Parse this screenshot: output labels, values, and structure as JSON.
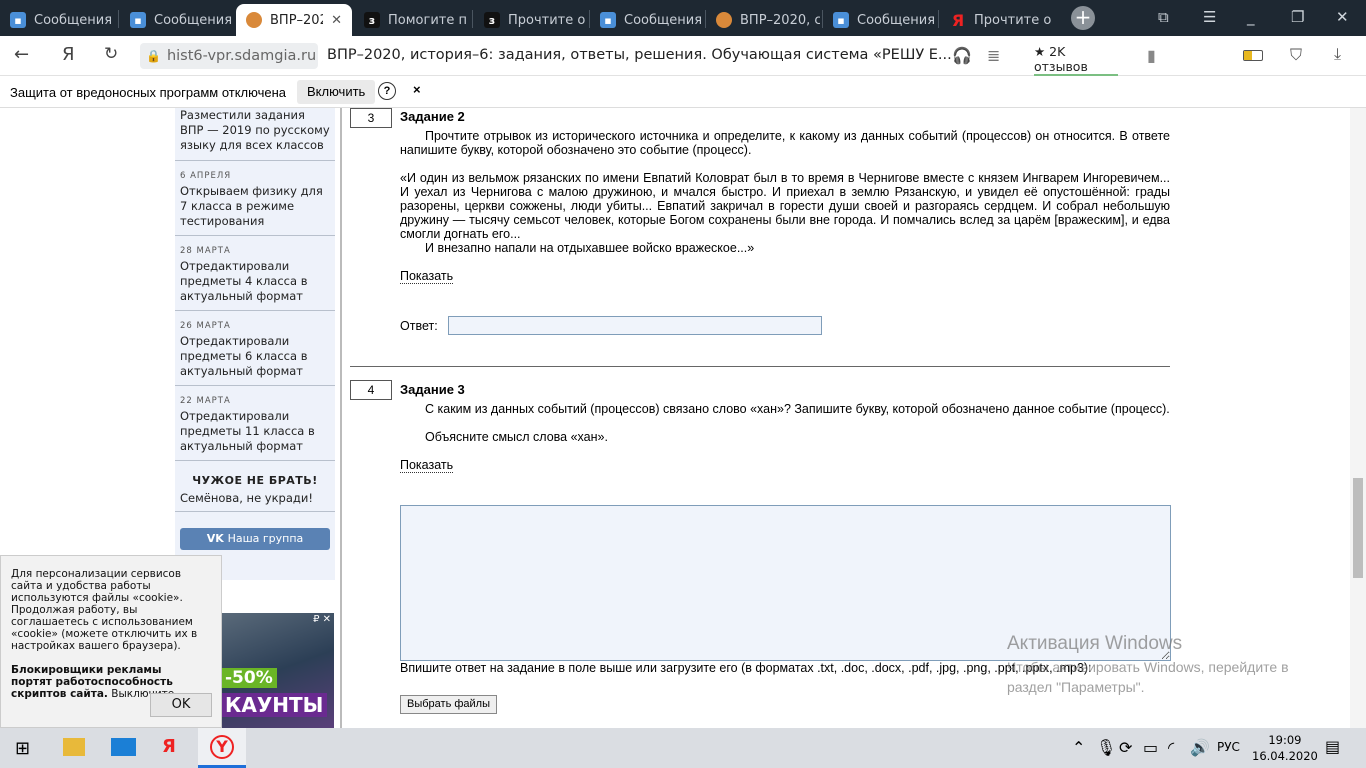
{
  "browser": {
    "tabs": [
      {
        "label": "Сообщения",
        "icon": "messages-icon"
      },
      {
        "label": "Сообщения",
        "icon": "messages-icon"
      },
      {
        "label": "ВПР–2020",
        "icon": "sdamgia-icon",
        "active": true
      },
      {
        "label": "Помогите п",
        "icon": "znanija-icon"
      },
      {
        "label": "Прочтите о",
        "icon": "znanija-icon"
      },
      {
        "label": "Сообщения",
        "icon": "messages-icon"
      },
      {
        "label": "ВПР–2020, с",
        "icon": "sdamgia-icon"
      },
      {
        "label": "Сообщения",
        "icon": "messages-icon"
      },
      {
        "label": "Прочтите о",
        "icon": "yandex-icon"
      }
    ],
    "domain": "hist6-vpr.sdamgia.ru",
    "page_title": "ВПР–2020, история–6: задания, ответы, решения. Обучающая система «РЕШУ Е...",
    "reviews": "★ 2K отзывов",
    "notice": {
      "text": "Защита от вредоносных программ отключена",
      "button": "Включить",
      "help": "?",
      "close": "×"
    }
  },
  "sidebar": {
    "news": [
      {
        "date": "",
        "title": "Разместили задания ВПР — 2019 по русскому языку для всех классов"
      },
      {
        "date": "6 АПРЕЛЯ",
        "title": "Открываем физику для 7 класса в режиме тестирования"
      },
      {
        "date": "28 МАРТА",
        "title": "Отредактировали предметы 4 класса в актуальный формат"
      },
      {
        "date": "26 МАРТА",
        "title": "Отредактировали предметы 6 класса в актуальный формат"
      },
      {
        "date": "22 МАРТА",
        "title": "Отредактировали предметы 11 класса в актуальный формат"
      }
    ],
    "notice_title": "ЧУЖОЕ НЕ БРАТЬ!",
    "notice_text": "Семёнова, не укради!",
    "vk_button": "Наша группа",
    "ad_text": "-50%",
    "ad_text2": "КАУНТЫ"
  },
  "cookie": {
    "text": "Для персонализации сервисов сайта и удобства работы используются файлы «cookie». Продолжая работу, вы соглашаетесь с использованием «cookie» (можете отключить их в настройках вашего браузера).",
    "bold": "Блокировщики рекламы портят работоспособность скриптов сайта.",
    "tail": " Выключите.",
    "ok": "OK"
  },
  "tasks": [
    {
      "number": "3",
      "title": "Задание 2",
      "text": "Прочтите отрывок из исторического источника и определите, к какому из данных событий (процессов) он относится. В ответе напишите букву, которой обозначено это событие (процесс).",
      "quote": "«И один из вельмож рязанских по имени Евпатий Коловрат был в то время в Чернигове вместе с князем Ингварем Ингоревичем... И уехал из Чернигова с малою дружиною, и мчался быстро. И приехал в землю Рязанскую, и увидел её опустошённой: грады разорены, церкви сожжены, люди убиты... Евпатий закричал в горести души своей и разгораясь сердцем. И собрал небольшую дружину — тысячу семьсот человек, которые Богом сохранены были вне города. И помчались вслед за царём [вражеским], и едва смогли догнать его...",
      "quote2": "И внезапно напали на отдыхавшее войско вражеское...»",
      "show": "Показать",
      "answer_label": "Ответ:",
      "answer_value": ""
    },
    {
      "number": "4",
      "title": "Задание 3",
      "text": "С каким из данных событий (процессов) связано слово «хан»? Запишите букву, которой обозначено данное событие (процесс).",
      "text2": "Объясните смысл слова «хан».",
      "show": "Показать",
      "upload_hint": "Впишите ответ на задание в поле выше или загрузите его (в форматах .txt, .doc, .docx, .pdf, .jpg, .png, .ppt, .pptx, .mp3):",
      "choose_files": "Выбрать файлы"
    }
  ],
  "watermark": {
    "title": "Активация Windows",
    "text": "Чтобы активировать Windows, перейдите в раздел \"Параметры\"."
  },
  "taskbar": {
    "lang": "РУС",
    "time": "19:09",
    "date": "16.04.2020"
  }
}
